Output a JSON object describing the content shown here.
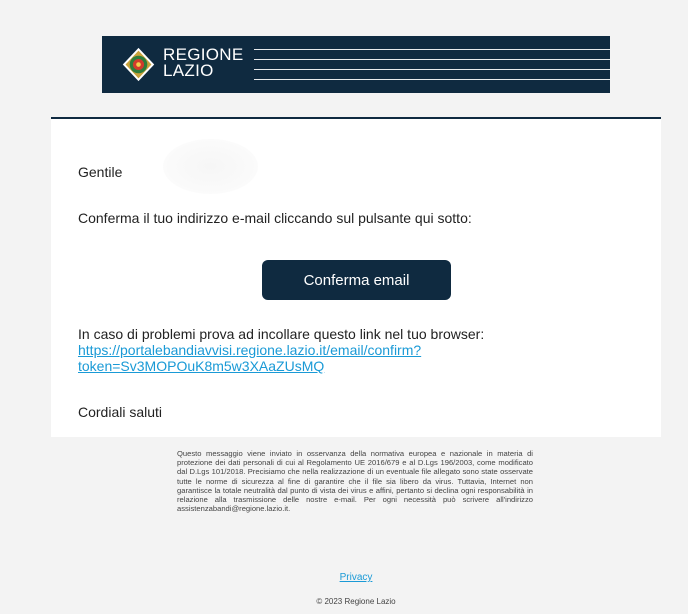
{
  "brand": {
    "name_line1": "REGIONE",
    "name_line2": "LAZIO",
    "colors": {
      "banner": "#0f2a40",
      "accent": "#1a9ad6"
    },
    "logo_icon": "regione-lazio-crest-icon"
  },
  "message": {
    "greeting": "Gentile",
    "instruction": "Conferma il tuo indirizzo e-mail cliccando sul pulsante qui sotto:",
    "confirm_button": "Conferma email",
    "problem_text": "In caso di problemi prova ad incollare questo link nel tuo browser:",
    "link_line1": "https://portalebandiavvisi.regione.lazio.it/email/confirm?",
    "link_line2": "token=Sv3MOPOuK8m5w3XAaZUsMQ",
    "regards": "Cordiali saluti"
  },
  "footer": {
    "disclaimer": "Questo messaggio viene inviato in osservanza della normativa europea e nazionale in materia di protezione dei dati personali di cui al Regolamento UE 2016/679 e al D.Lgs 196/2003, come modificato dal D.Lgs 101/2018. Precisiamo che nella realizzazione di un eventuale file allegato sono state osservate tutte le norme di sicurezza al fine di garantire che il file sia libero da virus. Tuttavia, Internet non garantisce la totale neutralità dal punto di vista dei virus e affini, pertanto si declina ogni responsabilità in relazione alla trasmissione delle nostre e-mail. Per ogni necessità può scrivere all'indirizzo assistenzabandi@regione.lazio.it.",
    "privacy": "Privacy",
    "copyright": "© 2023 Regione Lazio"
  }
}
